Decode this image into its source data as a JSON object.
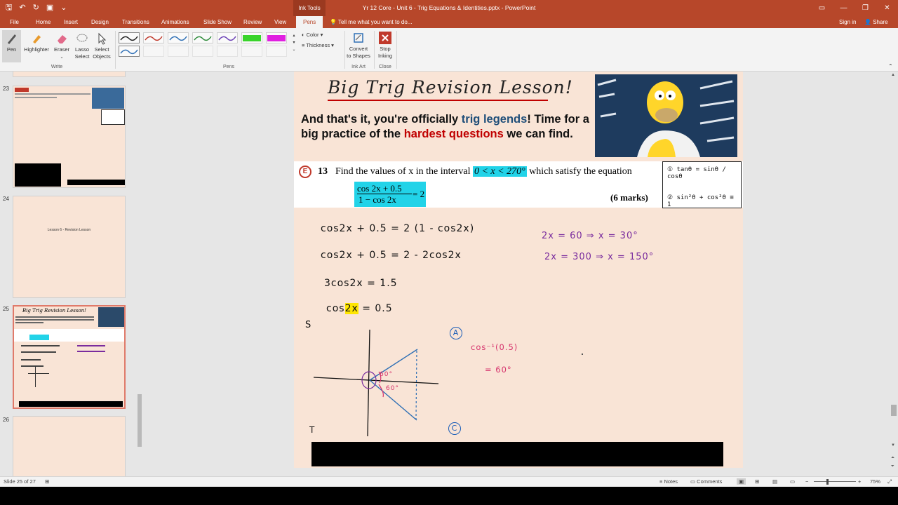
{
  "titlebar": {
    "context_tab": "Ink Tools",
    "document_title": "Yr 12 Core - Unit 6 - Trig Equations & Identities.pptx - PowerPoint"
  },
  "tabs": [
    "File",
    "Home",
    "Insert",
    "Design",
    "Transitions",
    "Animations",
    "Slide Show",
    "Review",
    "View",
    "Pens"
  ],
  "active_tab": "Pens",
  "tell_me": "Tell me what you want to do...",
  "account": {
    "signin": "Sign in",
    "share": "Share"
  },
  "ribbon": {
    "write": {
      "label": "Write",
      "pen": "Pen",
      "highlighter": "Highlighter",
      "eraser": "Eraser",
      "lasso_1": "Lasso",
      "lasso_2": "Select",
      "select_1": "Select",
      "select_2": "Objects"
    },
    "pens": {
      "label": "Pens",
      "color": "Color",
      "thickness": "Thickness"
    },
    "ink_art": {
      "label": "Ink Art",
      "convert_1": "Convert",
      "convert_2": "to Shapes"
    },
    "close": {
      "label": "Close",
      "stop_1": "Stop",
      "stop_2": "Inking"
    },
    "pen_colors": [
      "#1f1f1f",
      "#c0392b",
      "#2e6fb5",
      "#2e8b3a",
      "#6a3fb5",
      "#39d42b",
      "#e020e0",
      "#2e6fb5"
    ]
  },
  "thumbnails": {
    "numbers": [
      "23",
      "24",
      "25",
      "26"
    ],
    "slide24_text": "Lesson 6 - Revision Lesson",
    "slide25_title": "Big Trig Revision Lesson!"
  },
  "slide": {
    "title": "Big Trig Revision Lesson!",
    "intro_a": "And that's it, you're officially ",
    "intro_blue": "trig legends",
    "intro_b": "! Time for a big practice of the ",
    "intro_red": "hardest questions",
    "intro_c": " we can find.",
    "question": {
      "badge": "E",
      "number": "13",
      "text_a": "Find the values of x in the interval ",
      "interval": "0 < x < 270°",
      "text_b": " which satisfy the equation",
      "numerator": "cos 2x + 0.5",
      "denominator": "1 − cos 2x",
      "equals": "= 2",
      "marks": "(6 marks)"
    },
    "identities": {
      "one": "① tanθ = sinθ / cosθ",
      "two": "② sin²θ + cos²θ ≡ 1"
    },
    "working": {
      "line1": "cos2x + 0.5 = 2 (1 - cos2x)",
      "line2": "cos2x + 0.5 = 2 - 2cos2x",
      "line3": "3cos2x = 1.5",
      "line4a": "cos",
      "line4b": "2x",
      "line4c": " = 0.5"
    },
    "solutions": {
      "s1": "2x = 60  ⇒  x = 30°",
      "s2": "2x = 300  ⇒  x = 150°"
    },
    "cast": {
      "s": "S",
      "t": "T",
      "a": "A",
      "c": "C",
      "angle1": "60°",
      "angle2": "60°"
    },
    "inverse": {
      "line1": "cos⁻¹(0.5)",
      "line2": "= 60°"
    }
  },
  "status": {
    "slide_info": "Slide 25 of 27",
    "notes": "Notes",
    "comments": "Comments",
    "zoom": "75%"
  }
}
